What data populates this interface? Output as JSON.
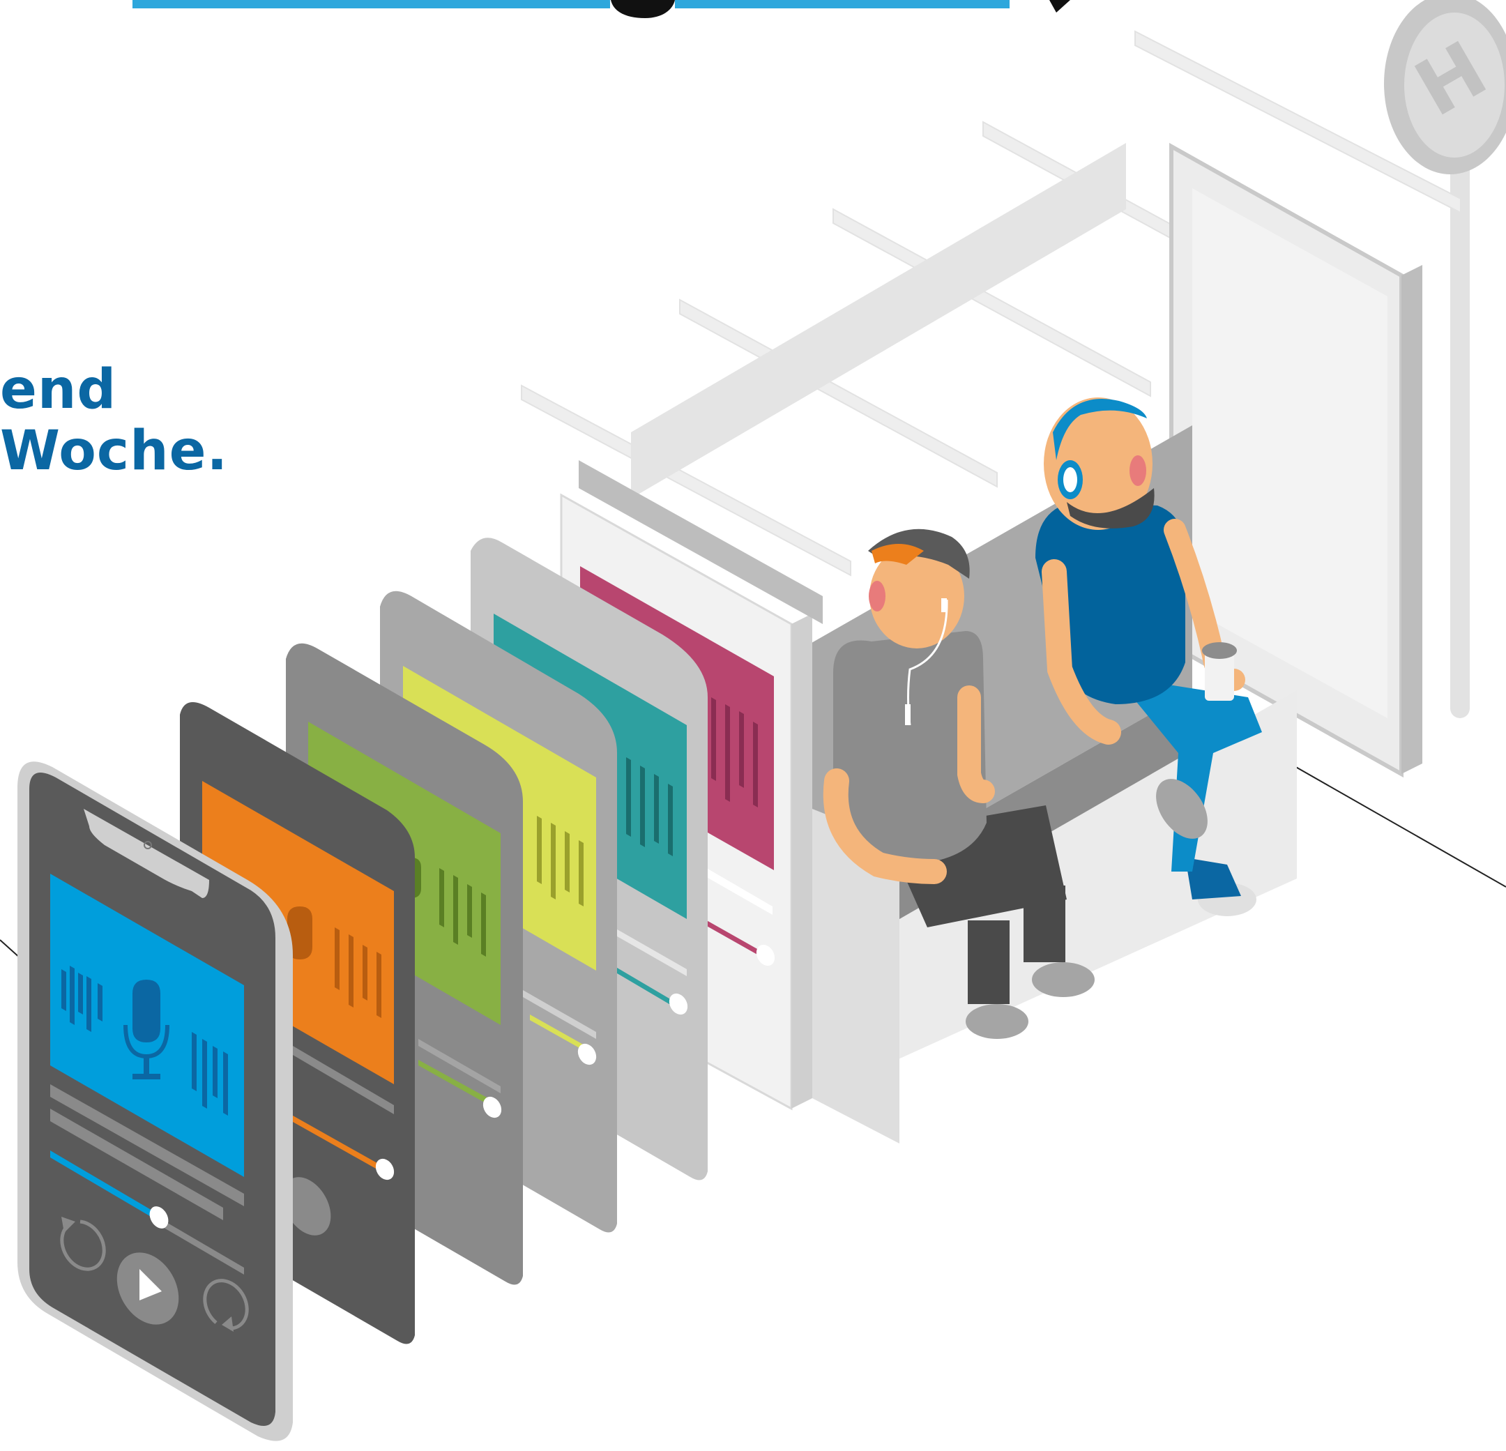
{
  "tagline": {
    "line1": "end",
    "line2": "Woche."
  },
  "headline_fragment": "g",
  "stop_sign": {
    "letter": "H"
  },
  "colors": {
    "headline_underline": "#2ea7dc",
    "tagline_text": "#0b67a3",
    "card_orange": "#ec7f1c",
    "card_green": "#88b044",
    "card_yellow": "#d9e056",
    "card_teal": "#2ea0a0",
    "card_magenta": "#b8466f",
    "card_blue": "#009edc",
    "skin": "#f4b57b",
    "shirt_blue": "#02639c",
    "jeans_blue": "#0c8cc8"
  },
  "icons": [
    "microphone-icon",
    "waveform-icon",
    "play-icon",
    "rewind-icon",
    "forward-icon",
    "bus-stop-sign-icon"
  ]
}
